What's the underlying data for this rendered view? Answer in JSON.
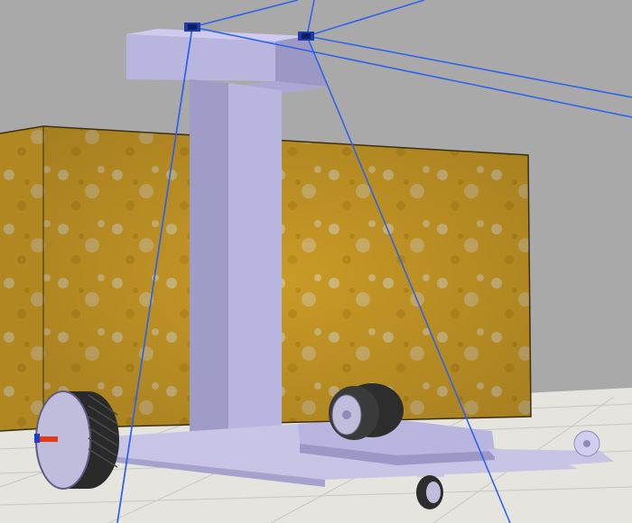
{
  "viewport": {
    "sky_color": "#a9a9a9",
    "ground_color": "#e8e6e0",
    "grid_line_color": "#c8c6c0"
  },
  "scene": {
    "wall": {
      "name": "textured-box",
      "color_front": "#c99a26",
      "color_side": "#b9891e",
      "stain_color": "#d8cfb7"
    },
    "robot": {
      "body_color": "#b8b5df",
      "body_shade": "#9b98c5",
      "body_light": "#cecbee"
    },
    "wheels": {
      "tire_color": "#2d2d2d",
      "hub_color": "#bfbcdc"
    },
    "ray_color": "#2f63ea",
    "axis_colors": {
      "x": "#e03b1c",
      "y": "#1d3ccc"
    },
    "sensor_color": "#1f3aa8"
  }
}
